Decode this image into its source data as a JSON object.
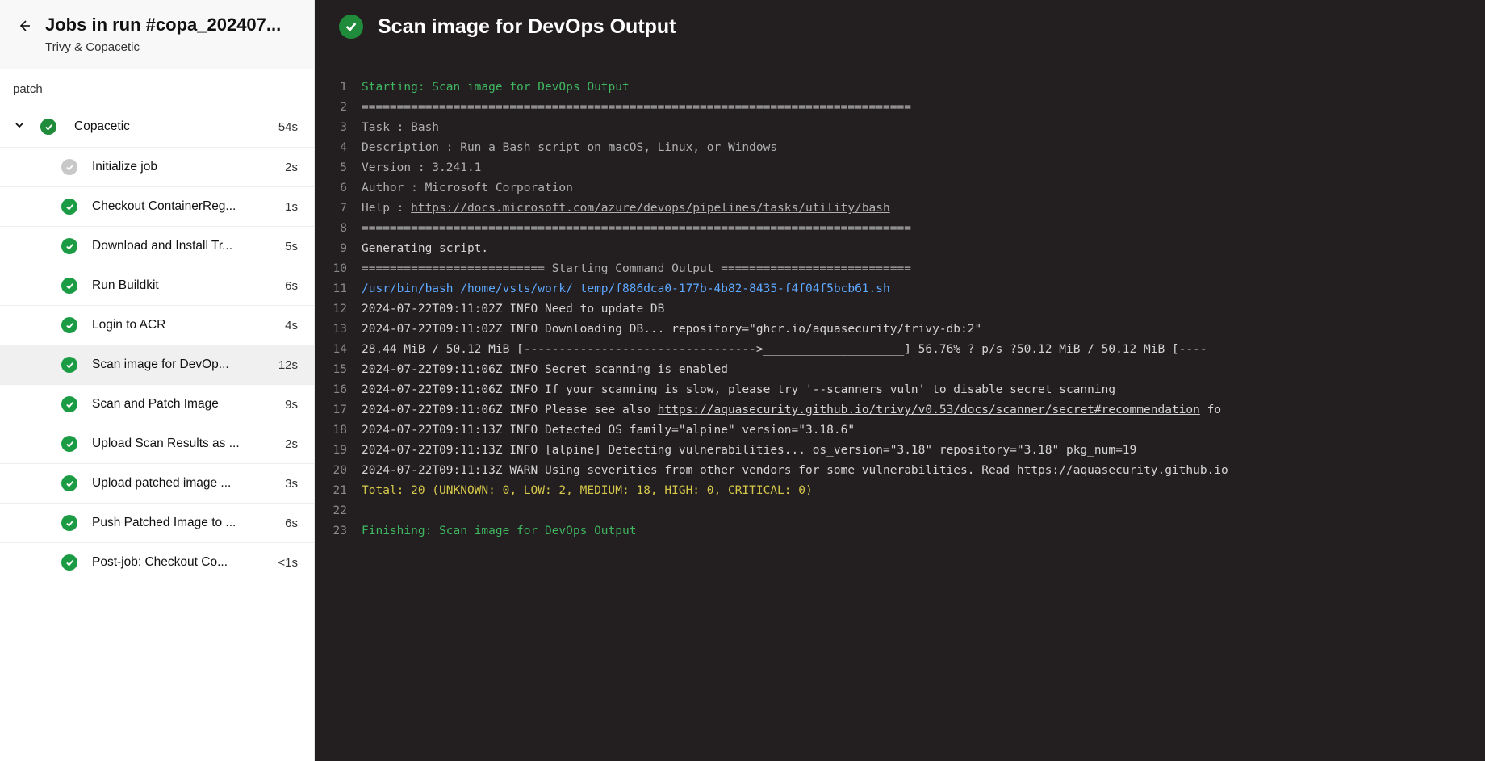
{
  "header": {
    "title": "Jobs in run #copa_202407...",
    "subtitle": "Trivy & Copacetic"
  },
  "stage": "patch",
  "job": {
    "name": "Copacetic",
    "duration": "54s"
  },
  "tasks": [
    {
      "name": "Initialize job",
      "duration": "2s",
      "status": "skipped"
    },
    {
      "name": "Checkout ContainerReg...",
      "duration": "1s",
      "status": "success"
    },
    {
      "name": "Download and Install Tr...",
      "duration": "5s",
      "status": "success"
    },
    {
      "name": "Run Buildkit",
      "duration": "6s",
      "status": "success"
    },
    {
      "name": "Login to ACR",
      "duration": "4s",
      "status": "success"
    },
    {
      "name": "Scan image for DevOp...",
      "duration": "12s",
      "status": "success",
      "selected": true
    },
    {
      "name": "Scan and Patch Image",
      "duration": "9s",
      "status": "success"
    },
    {
      "name": "Upload Scan Results as ...",
      "duration": "2s",
      "status": "success"
    },
    {
      "name": "Upload patched image ...",
      "duration": "3s",
      "status": "success"
    },
    {
      "name": "Push Patched Image to ...",
      "duration": "6s",
      "status": "success"
    },
    {
      "name": "Post-job: Checkout Co...",
      "duration": "<1s",
      "status": "success"
    }
  ],
  "logTitle": "Scan image for DevOps Output",
  "logLines": [
    {
      "n": 1,
      "cls": "c-green",
      "t": "Starting: Scan image for DevOps Output"
    },
    {
      "n": 2,
      "cls": "c-gray",
      "t": "=============================================================================="
    },
    {
      "n": 3,
      "cls": "c-gray",
      "t": "Task         : Bash"
    },
    {
      "n": 4,
      "cls": "c-gray",
      "t": "Description  : Run a Bash script on macOS, Linux, or Windows"
    },
    {
      "n": 5,
      "cls": "c-gray",
      "t": "Version      : 3.241.1"
    },
    {
      "n": 6,
      "cls": "c-gray",
      "t": "Author       : Microsoft Corporation"
    },
    {
      "n": 7,
      "cls": "c-gray",
      "h": "Help         : <a>https://docs.microsoft.com/azure/devops/pipelines/tasks/utility/bash</a>"
    },
    {
      "n": 8,
      "cls": "c-gray",
      "t": "=============================================================================="
    },
    {
      "n": 9,
      "cls": "c-white",
      "t": "Generating script."
    },
    {
      "n": 10,
      "cls": "c-gray",
      "t": "========================== Starting Command Output ==========================="
    },
    {
      "n": 11,
      "cls": "c-blue",
      "t": "/usr/bin/bash /home/vsts/work/_temp/f886dca0-177b-4b82-8435-f4f04f5bcb61.sh"
    },
    {
      "n": 12,
      "cls": "c-white",
      "t": "2024-07-22T09:11:02Z    INFO    Need to update DB"
    },
    {
      "n": 13,
      "cls": "c-white",
      "t": "2024-07-22T09:11:02Z    INFO    Downloading DB...       repository=\"ghcr.io/aquasecurity/trivy-db:2\""
    },
    {
      "n": 14,
      "cls": "c-white",
      "t": "28.44 MiB / 50.12 MiB [--------------------------------->____________________] 56.76% ? p/s ?50.12 MiB / 50.12 MiB [----"
    },
    {
      "n": 15,
      "cls": "c-white",
      "t": "2024-07-22T09:11:06Z    INFO    Secret scanning is enabled"
    },
    {
      "n": 16,
      "cls": "c-white",
      "t": "2024-07-22T09:11:06Z    INFO    If your scanning is slow, please try '--scanners vuln' to disable secret scanning"
    },
    {
      "n": 17,
      "cls": "c-white",
      "h": "2024-07-22T09:11:06Z    INFO    Please see also <a>https://aquasecurity.github.io/trivy/v0.53/docs/scanner/secret#recommendation</a> fo"
    },
    {
      "n": 18,
      "cls": "c-white",
      "t": "2024-07-22T09:11:13Z    INFO    Detected OS    family=\"alpine\" version=\"3.18.6\""
    },
    {
      "n": 19,
      "cls": "c-white",
      "t": "2024-07-22T09:11:13Z    INFO    [alpine] Detecting vulnerabilities...   os_version=\"3.18\" repository=\"3.18\" pkg_num=19"
    },
    {
      "n": 20,
      "cls": "c-white",
      "h": "2024-07-22T09:11:13Z    WARN    Using severities from other vendors for some vulnerabilities. Read <a>https://aquasecurity.github.io</a>"
    },
    {
      "n": 21,
      "cls": "c-yellow",
      "t": "Total: 20 (UNKNOWN: 0, LOW: 2, MEDIUM: 18, HIGH: 0, CRITICAL: 0)"
    },
    {
      "n": 22,
      "cls": "c-white",
      "t": ""
    },
    {
      "n": 23,
      "cls": "c-green",
      "t": "Finishing: Scan image for DevOps Output"
    }
  ]
}
